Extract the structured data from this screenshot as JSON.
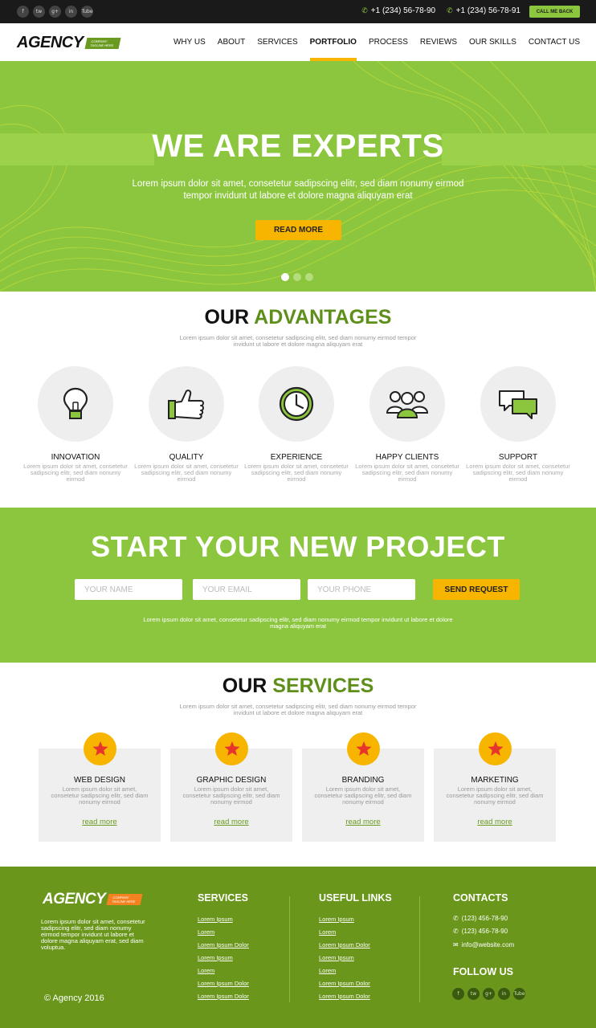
{
  "topbar": {
    "social": [
      {
        "icon": "facebook-icon",
        "label": "f"
      },
      {
        "icon": "twitter-icon",
        "label": "tw"
      },
      {
        "icon": "googleplus-icon",
        "label": "g+"
      },
      {
        "icon": "linkedin-icon",
        "label": "in"
      },
      {
        "icon": "youtube-icon",
        "label": "Tube"
      }
    ],
    "phone1": "+1 (234) 56-78-90",
    "phone2": "+1 (234) 56-78-91",
    "call_label": "CALL ME BACK"
  },
  "nav": {
    "logo": "AGENCY",
    "logo_tag": "COMPANY TAGLINE HERE",
    "items": [
      "WHY US",
      "ABOUT",
      "SERVICES",
      "PORTFOLIO",
      "PROCESS",
      "REVIEWS",
      "OUR SKILLS",
      "CONTACT US"
    ],
    "active": "PORTFOLIO"
  },
  "hero": {
    "title": "WE ARE EXPERTS",
    "subtitle": "Lorem ipsum dolor sit amet, consetetur sadipscing elitr, sed diam nonumy eirmod tempor invidunt ut labore et dolore magna aliquyam erat",
    "button": "READ MORE",
    "slides": 3,
    "active_slide": 1
  },
  "advantages": {
    "title_plain": "OUR",
    "title_accent": "ADVANTAGES",
    "subtitle": "Lorem ipsum dolor sit amet, consetetur sadipscing elitr, sed diam nonumy eirmod tempor invidunt ut labore et dolore magna aliquyam erat",
    "items": [
      {
        "icon": "lightbulb-icon",
        "title": "INNOVATION",
        "text": "Lorem ipsum dolor sit amet, consetetur sadipscing elitr, sed diam nonumy eirmod"
      },
      {
        "icon": "thumbs-up-icon",
        "title": "QUALITY",
        "text": "Lorem ipsum dolor sit amet, consetetur sadipscing elitr, sed diam nonumy eirmod"
      },
      {
        "icon": "clock-icon",
        "title": "EXPERIENCE",
        "text": "Lorem ipsum dolor sit amet, consetetur sadipscing elitr, sed diam nonumy eirmod"
      },
      {
        "icon": "people-icon",
        "title": "HAPPY CLIENTS",
        "text": "Lorem ipsum dolor sit amet, consetetur sadipscing elitr, sed diam nonumy eirmod"
      },
      {
        "icon": "chat-icon",
        "title": "SUPPORT",
        "text": "Lorem ipsum dolor sit amet, consetetur sadipscing elitr, sed diam nonumy eirmod"
      }
    ]
  },
  "project": {
    "title": "START YOUR NEW PROJECT",
    "name_placeholder": "YOUR NAME",
    "email_placeholder": "YOUR EMAIL",
    "phone_placeholder": "YOUR PHONE",
    "button": "SEND REQUEST",
    "text": "Lorem ipsum dolor sit amet, consetetur sadipscing elitr, sed diam nonumy eirmod tempor invidunt ut labore et dolore magna aliquyam erat"
  },
  "services": {
    "title_plain": "OUR",
    "title_accent": "SERVICES",
    "subtitle": "Lorem ipsum dolor sit amet, consetetur sadipscing elitr, sed diam nonumy eirmod tempor invidunt ut labore et dolore magna aliquyam erat",
    "items": [
      {
        "title": "WEB DESIGN",
        "text": "Lorem ipsum dolor sit amet, consetetur sadipscing elitr, sed diam nonumy eirmod",
        "link": "read more"
      },
      {
        "title": "GRAPHIC DESIGN",
        "text": "Lorem ipsum dolor sit amet, consetetur sadipscing elitr, sed diam nonumy eirmod",
        "link": "read more"
      },
      {
        "title": "BRANDING",
        "text": "Lorem ipsum dolor sit amet, consetetur sadipscing elitr, sed diam nonumy eirmod",
        "link": "read more"
      },
      {
        "title": "MARKETING",
        "text": "Lorem ipsum dolor sit amet, consetetur sadipscing elitr, sed diam nonumy eirmod",
        "link": "read more"
      }
    ]
  },
  "footer": {
    "logo": "AGENCY",
    "logo_tag": "COMPANY TAGLINE HERE",
    "about": "Lorem ipsum dolor sit amet, consetetur sadipscing elitr, sed diam nonumy eirmod tempor invidunt ut labore et dolore magna aliquyam erat, sed diam voluptua.",
    "copyright": "© Agency 2016",
    "services_title": "SERVICES",
    "services_links": [
      "Lorem Ipsum",
      "Lorem",
      "Lorem Ipsum Dolor",
      "Lorem Ipsum",
      "Lorem",
      "Lorem Ipsum Dolor",
      "Lorem Ipsum Dolor"
    ],
    "useful_title": "USEFUL LINKS",
    "useful_links": [
      "Lorem Ipsum",
      "Lorem",
      "Lorem Ipsum Dolor",
      "Lorem Ipsum",
      "Lorem",
      "Lorem Ipsum Dolor",
      "Lorem Ipsum Dolor"
    ],
    "contacts_title": "CONTACTS",
    "phone1": "(123) 456-78-90",
    "phone2": "(123) 456-78-90",
    "email": "info@website.com",
    "follow_title": "FOLLOW US",
    "social": [
      {
        "icon": "facebook-icon",
        "label": "f"
      },
      {
        "icon": "twitter-icon",
        "label": "tw"
      },
      {
        "icon": "googleplus-icon",
        "label": "g+"
      },
      {
        "icon": "linkedin-icon",
        "label": "in"
      },
      {
        "icon": "youtube-icon",
        "label": "Tube"
      }
    ]
  },
  "colors": {
    "brand_green": "#8cc63f",
    "dark_green": "#6a961b",
    "accent_yellow": "#f7b500",
    "topbar": "#1a1a1a"
  }
}
